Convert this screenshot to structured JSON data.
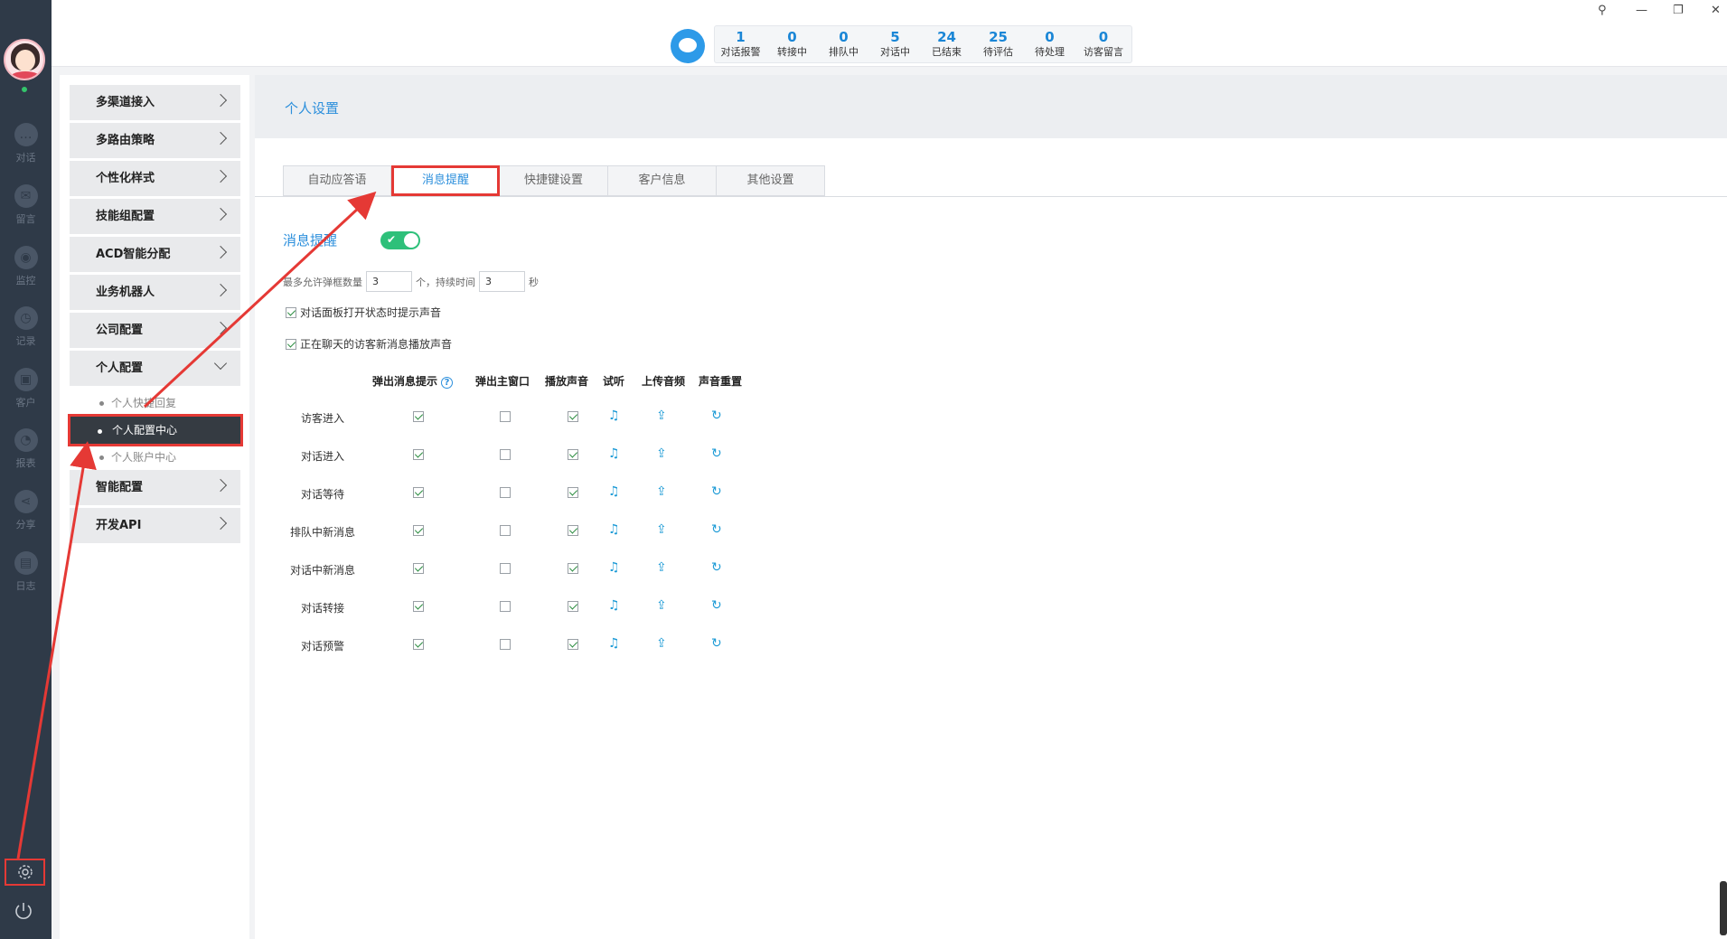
{
  "leftnav": {
    "items": [
      {
        "label": "对话",
        "icon": "chat-icon",
        "glyph": "…"
      },
      {
        "label": "留言",
        "icon": "mail-icon",
        "glyph": "✉"
      },
      {
        "label": "监控",
        "icon": "eye-icon",
        "glyph": "◉"
      },
      {
        "label": "记录",
        "icon": "clock-icon",
        "glyph": "◷"
      },
      {
        "label": "客户",
        "icon": "contact-card-icon",
        "glyph": "▣"
      },
      {
        "label": "报表",
        "icon": "pie-chart-icon",
        "glyph": "◔"
      },
      {
        "label": "分享",
        "icon": "share-icon",
        "glyph": "⋖"
      },
      {
        "label": "日志",
        "icon": "clipboard-icon",
        "glyph": "▤"
      }
    ]
  },
  "topbar": {
    "stats": [
      {
        "num": "1",
        "label": "对话报警"
      },
      {
        "num": "0",
        "label": "转接中"
      },
      {
        "num": "0",
        "label": "排队中"
      },
      {
        "num": "5",
        "label": "对话中"
      },
      {
        "num": "24",
        "label": "已结束"
      },
      {
        "num": "25",
        "label": "待评估"
      },
      {
        "num": "0",
        "label": "待处理"
      },
      {
        "num": "0",
        "label": "访客留言"
      }
    ]
  },
  "submenu": {
    "items": [
      {
        "label": "多渠道接入"
      },
      {
        "label": "多路由策略"
      },
      {
        "label": "个性化样式"
      },
      {
        "label": "技能组配置"
      },
      {
        "label": "ACD智能分配"
      },
      {
        "label": "业务机器人"
      },
      {
        "label": "公司配置"
      },
      {
        "label": "个人配置"
      }
    ],
    "subitems": [
      {
        "label": "个人快捷回复"
      },
      {
        "label": "个人配置中心"
      },
      {
        "label": "个人账户中心"
      }
    ],
    "items_after": [
      {
        "label": "智能配置"
      },
      {
        "label": "开发API"
      }
    ]
  },
  "main": {
    "title": "个人设置",
    "tabs": [
      "自动应答语",
      "消息提醒",
      "快捷键设置",
      "客户信息",
      "其他设置"
    ],
    "active_tab": "消息提醒",
    "section_title": "消息提醒",
    "max_popup_label": "最多允许弹框数量",
    "max_popup_value": "3",
    "unit_ge": "个，持续时间",
    "duration_value": "3",
    "unit_sec": "秒",
    "opt1": "对话面板打开状态时提示声音",
    "opt2": "正在聊天的访客新消息播放声音",
    "columns": [
      "弹出消息提示",
      "弹出主窗口",
      "播放声音",
      "试听",
      "上传音频",
      "声音重置"
    ],
    "rows": [
      {
        "label": "访客进入",
        "popup": true,
        "main_window": false,
        "sound": true
      },
      {
        "label": "对话进入",
        "popup": true,
        "main_window": false,
        "sound": true
      },
      {
        "label": "对话等待",
        "popup": true,
        "main_window": false,
        "sound": true
      },
      {
        "label": "排队中新消息",
        "popup": true,
        "main_window": false,
        "sound": true
      },
      {
        "label": "对话中新消息",
        "popup": true,
        "main_window": false,
        "sound": true
      },
      {
        "label": "对话转接",
        "popup": true,
        "main_window": false,
        "sound": true
      },
      {
        "label": "对话预警",
        "popup": true,
        "main_window": false,
        "sound": true
      }
    ]
  },
  "colors": {
    "accent": "#2c8fdc",
    "highlight": "#e53935",
    "nav_bg": "#2f3a48",
    "toggle_on": "#2ec07a"
  }
}
